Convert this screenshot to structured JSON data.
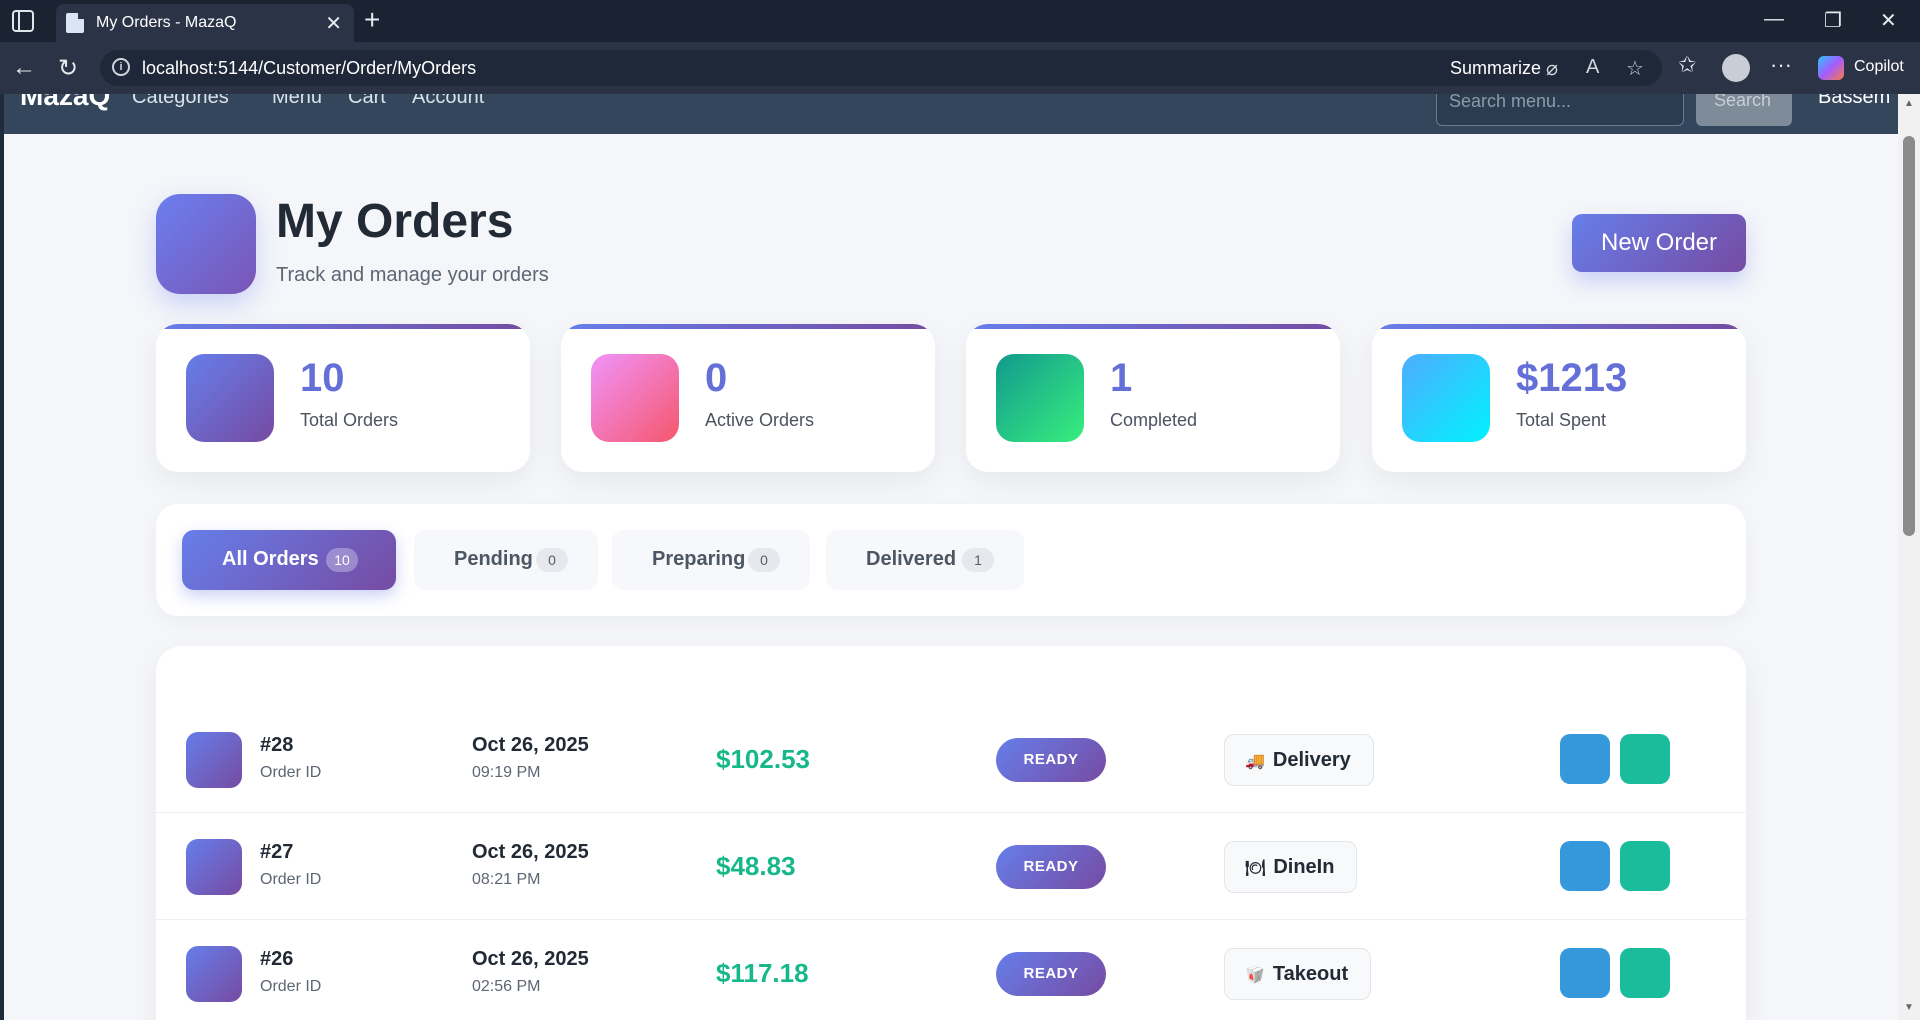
{
  "browser": {
    "tab_title": "My Orders - MazaQ",
    "url": "localhost:5144/Customer/Order/MyOrders",
    "summarize_label": "Summarize",
    "copilot_label": "Copilot"
  },
  "site_nav": {
    "brand": "MazaQ",
    "links": [
      "Categories",
      "Menu",
      "Cart",
      "Account"
    ],
    "search_placeholder": "Search menu...",
    "search_button": "Search",
    "user": "Bassem"
  },
  "header": {
    "title": "My Orders",
    "subtitle": "Track and manage your orders",
    "new_order_label": "New Order"
  },
  "stats": [
    {
      "value": "10",
      "label": "Total Orders",
      "color": "#667eea"
    },
    {
      "value": "0",
      "label": "Active Orders",
      "color": "#f5576c"
    },
    {
      "value": "1",
      "label": "Completed",
      "color": "#11998e"
    },
    {
      "value": "$1213",
      "label": "Total Spent",
      "color": "#4facfe"
    }
  ],
  "filters": [
    {
      "label": "All Orders",
      "count": "10",
      "active": true
    },
    {
      "label": "Pending",
      "count": "0",
      "active": false
    },
    {
      "label": "Preparing",
      "count": "0",
      "active": false
    },
    {
      "label": "Delivered",
      "count": "1",
      "active": false
    }
  ],
  "orders": [
    {
      "id": "#28",
      "id_label": "Order ID",
      "date": "Oct 26, 2025",
      "time": "09:19 PM",
      "amount": "$102.53",
      "status": "READY",
      "type_icon": "🚚",
      "type": "Delivery"
    },
    {
      "id": "#27",
      "id_label": "Order ID",
      "date": "Oct 26, 2025",
      "time": "08:21 PM",
      "amount": "$48.83",
      "status": "READY",
      "type_icon": "🍽",
      "type": "DineIn"
    },
    {
      "id": "#26",
      "id_label": "Order ID",
      "date": "Oct 26, 2025",
      "time": "02:56 PM",
      "amount": "$117.18",
      "status": "READY",
      "type_icon": "🥡",
      "type": "Takeout"
    }
  ]
}
